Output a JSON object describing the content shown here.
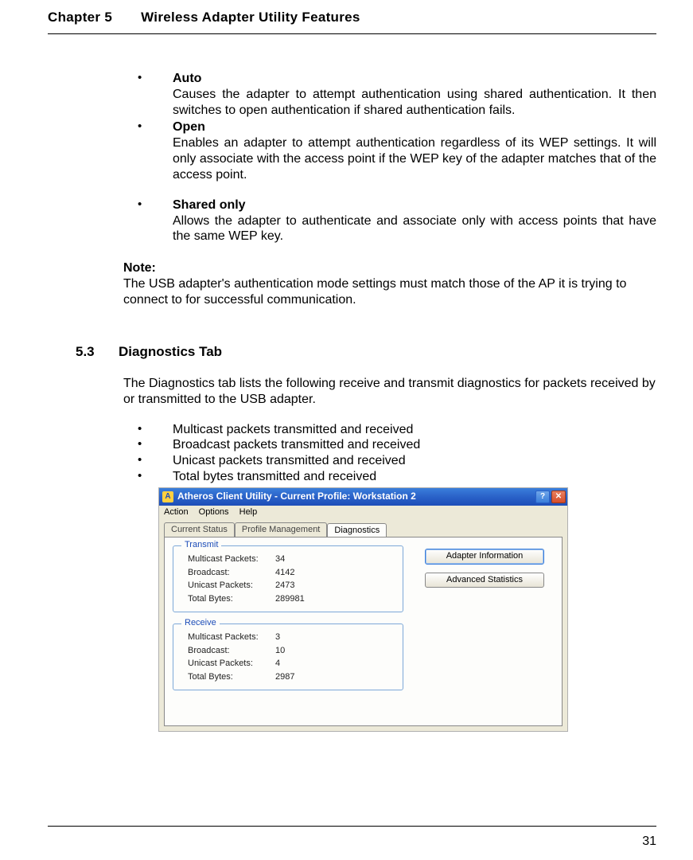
{
  "header": {
    "chapter": "Chapter 5",
    "title": "Wireless Adapter Utility Features"
  },
  "auth_modes": {
    "auto": {
      "title": "Auto",
      "desc": "Causes the adapter to attempt authentication using shared authentication. It then switches to open authentication if shared authentication fails."
    },
    "open": {
      "title": "Open",
      "desc": "Enables an adapter to attempt authentication regardless of its WEP settings. It will only associate with the access point if the WEP key of the adapter matches that of the access point."
    },
    "shared": {
      "title": "Shared only",
      "desc": "Allows the adapter to authenticate and associate only with access points that have the same WEP key."
    }
  },
  "note": {
    "title": "Note:",
    "text": "The USB adapter's authentication mode settings must match those of the AP it is trying to connect to for successful communication."
  },
  "section": {
    "num": "5.3",
    "title": "Diagnostics Tab",
    "intro": "The Diagnostics tab lists the following receive and transmit diagnostics for packets received by or transmitted to the USB adapter.",
    "bullets": [
      "Multicast packets transmitted and received",
      "Broadcast packets transmitted and received",
      "Unicast packets transmitted and received",
      "Total bytes transmitted and received"
    ]
  },
  "dialog": {
    "title": "Atheros Client Utility - Current Profile: Workstation 2",
    "menus": [
      "Action",
      "Options",
      "Help"
    ],
    "tabs": [
      "Current Status",
      "Profile Management",
      "Diagnostics"
    ],
    "active_tab": "Diagnostics",
    "transmit": {
      "title": "Transmit",
      "rows": [
        {
          "label": "Multicast Packets:",
          "value": "34"
        },
        {
          "label": "Broadcast:",
          "value": "4142"
        },
        {
          "label": "Unicast Packets:",
          "value": "2473"
        },
        {
          "label": "Total Bytes:",
          "value": "289981"
        }
      ]
    },
    "receive": {
      "title": "Receive",
      "rows": [
        {
          "label": "Multicast Packets:",
          "value": "3"
        },
        {
          "label": "Broadcast:",
          "value": "10"
        },
        {
          "label": "Unicast Packets:",
          "value": "4"
        },
        {
          "label": "Total Bytes:",
          "value": "2987"
        }
      ]
    },
    "buttons": {
      "adapter_info": "Adapter Information",
      "adv_stats": "Advanced Statistics"
    }
  },
  "page_number": "31"
}
